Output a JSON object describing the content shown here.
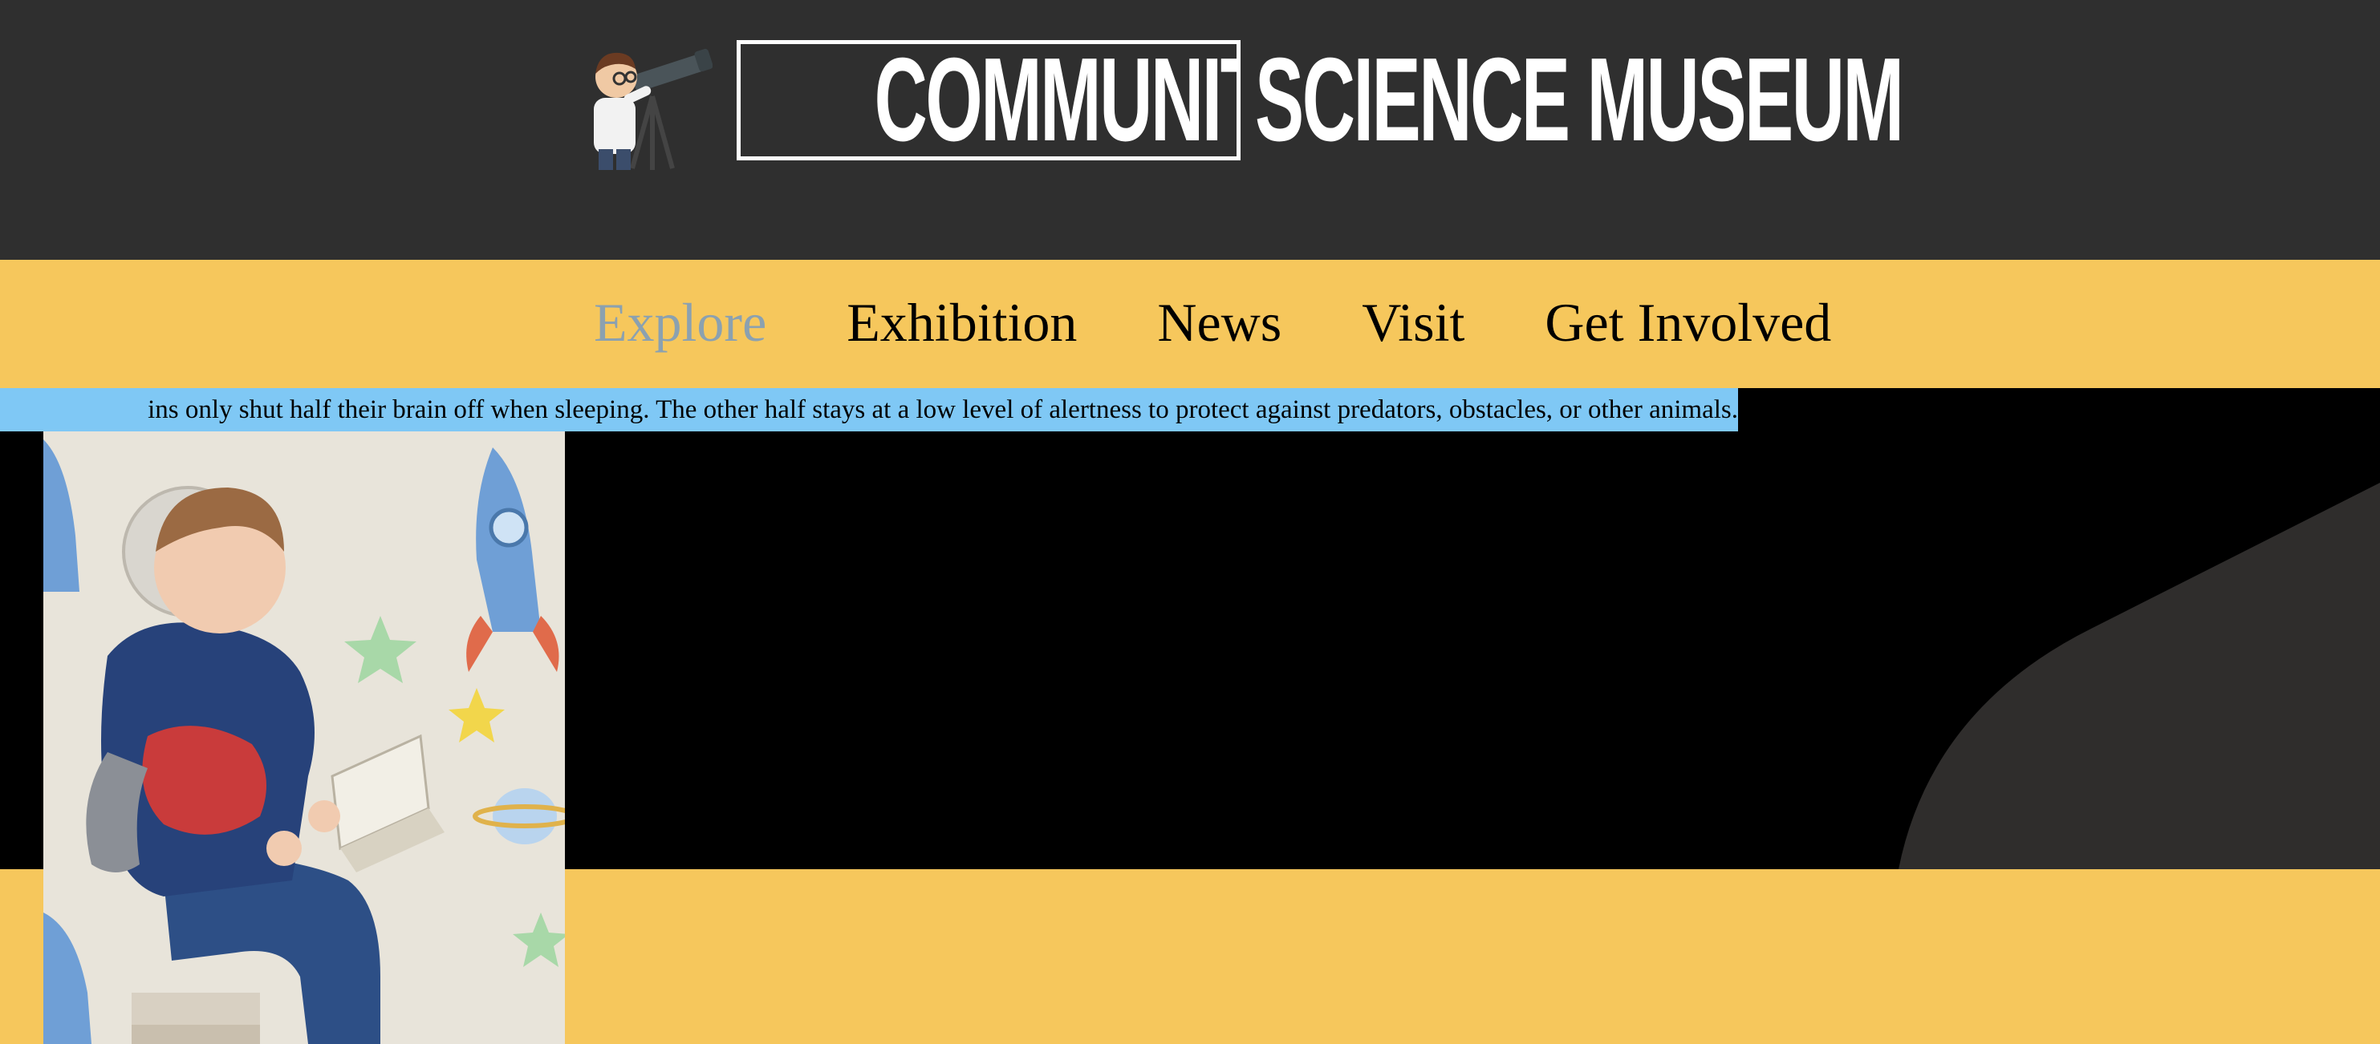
{
  "header": {
    "logo_boxed_text": "COMMUNITY",
    "logo_rest_text": "SCIENCE MUSEUM"
  },
  "nav": {
    "items": [
      {
        "label": "Explore",
        "active": true
      },
      {
        "label": "Exhibition",
        "active": false
      },
      {
        "label": "News",
        "active": false
      },
      {
        "label": "Visit",
        "active": false
      },
      {
        "label": "Get Involved",
        "active": false
      }
    ]
  },
  "hero": {
    "fact_text": "ins only shut half their brain off when sleeping. The other half stays at a low level of alertness to protect against predators, obstacles, or other animals."
  },
  "colors": {
    "header_bg": "#2f2f2f",
    "accent_yellow": "#f6c75c",
    "nav_active": "#8ba1b0",
    "fact_highlight": "#7fc8f5"
  }
}
